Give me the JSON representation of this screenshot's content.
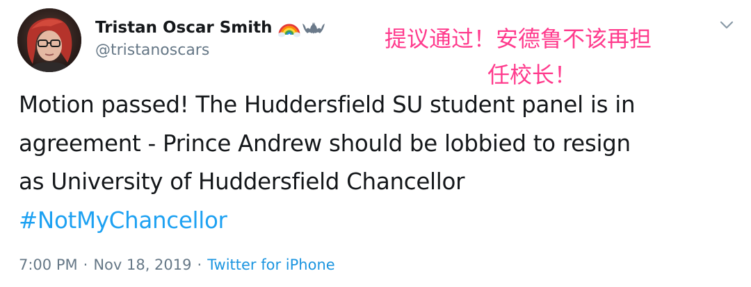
{
  "author": {
    "display_name": "Tristan Oscar Smith",
    "handle": "@tristanoscars",
    "badges": [
      "rainbow-icon",
      "bat-icon"
    ]
  },
  "overlay_caption": {
    "line1": "提议通过！安德鲁不该再担",
    "line2": "任校长！",
    "color": "#ff3b8d"
  },
  "tweet": {
    "lines": [
      "Motion passed! The Huddersfield SU student panel is in",
      "agreement - Prince Andrew should be lobbied to resign",
      "as University of Huddersfield Chancellor"
    ],
    "hashtag": "#NotMyChancellor"
  },
  "meta": {
    "time": "7:00 PM",
    "separator": "·",
    "date": "Nov 18, 2019",
    "source": "Twitter for iPhone"
  },
  "colors": {
    "link": "#1da1f2",
    "secondary_text": "#657786",
    "primary_text": "#14171a"
  },
  "icons": {
    "menu": "chevron-down-icon"
  }
}
